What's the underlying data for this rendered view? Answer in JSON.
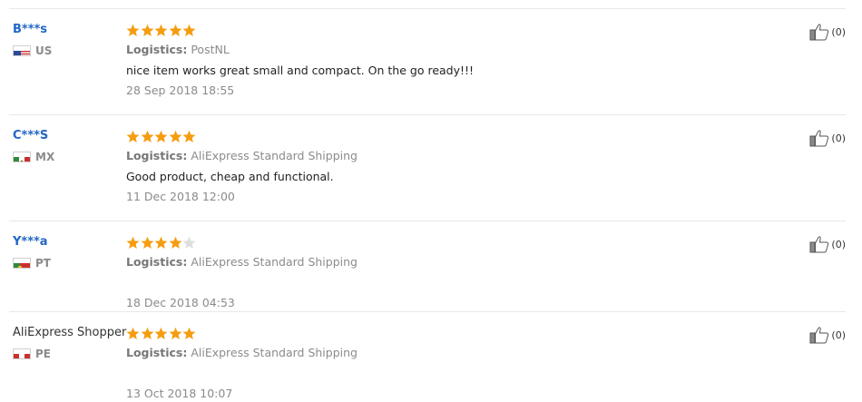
{
  "reviews": [
    {
      "user": "B***s",
      "country": "US",
      "stars_filled": 5,
      "stars_total": 5,
      "logistics_label": "Logistics:",
      "logistics": "PostNL",
      "text": "nice item works great small and compact. On the go ready!!!",
      "date": "28 Sep 2018 18:55",
      "helpful": "(0)"
    },
    {
      "user": "C***S",
      "country": "MX",
      "stars_filled": 5,
      "stars_total": 5,
      "logistics_label": "Logistics:",
      "logistics": "AliExpress Standard Shipping",
      "text": "Good product, cheap and functional.",
      "date": "11 Dec 2018 12:00",
      "helpful": "(0)"
    },
    {
      "user": "Y***a",
      "country": "PT",
      "stars_filled": 4,
      "stars_total": 5,
      "logistics_label": "Logistics:",
      "logistics": "AliExpress Standard Shipping",
      "text": "",
      "date": "18 Dec 2018 04:53",
      "helpful": "(0)"
    },
    {
      "user": "AliExpress Shopper",
      "country": "PE",
      "stars_filled": 5,
      "stars_total": 5,
      "logistics_label": "Logistics:",
      "logistics": "AliExpress Standard Shipping",
      "text": "",
      "date": "13 Oct 2018 10:07",
      "helpful": "(0)"
    }
  ],
  "colors": {
    "star": "#f59d10",
    "star_empty": "#dedede",
    "username": "#2267c4",
    "meta": "#8b8b8b"
  }
}
